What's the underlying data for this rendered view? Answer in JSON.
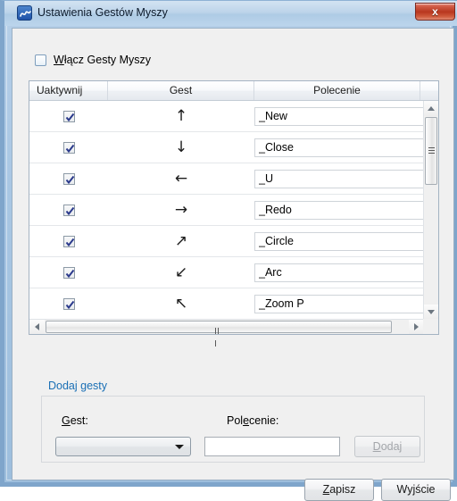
{
  "window": {
    "title": "Ustawienia Gestów Myszy",
    "icon": "app-squiggle-icon",
    "close_label": "x",
    "frame_color": "#7fa5cb",
    "titlebar_color": "#bdd4ea",
    "close_color": "#b8371f"
  },
  "enable": {
    "label_pre": "W",
    "label_post": "łącz Gesty Myszy",
    "checked": false
  },
  "grid": {
    "headers": [
      "Uaktywnij",
      "Gest",
      "Polecenie"
    ],
    "rows": [
      {
        "enabled": true,
        "gesture": "↑",
        "command": "_New"
      },
      {
        "enabled": true,
        "gesture": "↓",
        "command": "_Close"
      },
      {
        "enabled": true,
        "gesture": "←",
        "command": "_U"
      },
      {
        "enabled": true,
        "gesture": "→",
        "command": "_Redo"
      },
      {
        "enabled": true,
        "gesture": "↗",
        "command": "_Circle"
      },
      {
        "enabled": true,
        "gesture": "↙",
        "command": "_Arc"
      },
      {
        "enabled": true,
        "gesture": "↖",
        "command": "_Zoom P"
      }
    ],
    "vertical_scrollbar": {
      "up_icon": "triangle-up-icon",
      "down_icon": "triangle-down-icon",
      "thumb_grip": "grip-icon"
    },
    "horizontal_scrollbar": {
      "left_icon": "triangle-left-icon",
      "right_icon": "triangle-right-icon",
      "thumb_grip": "grip-icon"
    }
  },
  "add_group": {
    "title": "Dodaj gesty",
    "title_color": "#1a6fb5",
    "gesture_label_pre": "G",
    "gesture_label_post": "est:",
    "command_label_pre": "Pol",
    "command_label_mn": "e",
    "command_label_post": "cenie:",
    "gesture_select_value": "",
    "command_value": "",
    "command_placeholder": "",
    "add_button_pre": "D",
    "add_button_post": "odaj",
    "add_button_enabled": false,
    "chevron": "chevron-down-icon"
  },
  "footer": {
    "save_pre": "Z",
    "save_post": "apisz",
    "exit_pre": "Wy",
    "exit_mn": "j",
    "exit_post": "ście"
  }
}
